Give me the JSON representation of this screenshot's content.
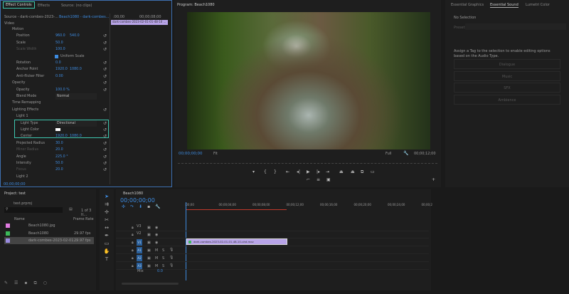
{
  "effect_controls": {
    "tabs": [
      "Effect Controls",
      "Effects",
      "Source: (no clips)"
    ],
    "source_label": "Source - dark-combes-2023-...",
    "clip_select": "Beach1080 - dark-combes...",
    "mini_time_start": ":00;00",
    "mini_time_end": "00;00;08;00",
    "clip_bar": "dark-combes-2023-02-01-01-48-10 ...",
    "section_video": "Video",
    "rows": [
      {
        "label": "Motion",
        "value": ""
      },
      {
        "label": "Position",
        "value": "960.0",
        "value2": "540.0"
      },
      {
        "label": "Scale",
        "value": "50.0"
      },
      {
        "label": "Scale Width",
        "value": "100.0"
      },
      {
        "label": "Uniform Scale",
        "value": ""
      },
      {
        "label": "Rotation",
        "value": "0.0"
      },
      {
        "label": "Anchor Point",
        "value": "1920.0",
        "value2": "1080.0"
      },
      {
        "label": "Anti-flicker Filter",
        "value": "0.00"
      },
      {
        "label": "Opacity",
        "value": ""
      },
      {
        "label": "Opacity",
        "value": "100.0 %"
      },
      {
        "label": "Blend Mode",
        "value": "Normal"
      },
      {
        "label": "Time Remapping",
        "value": ""
      },
      {
        "label": "Lighting Effects",
        "value": ""
      },
      {
        "label": "Light 1",
        "value": ""
      },
      {
        "label": "Light Type",
        "value": "Directional"
      },
      {
        "label": "Light Color",
        "value": ""
      },
      {
        "label": "Center",
        "value": "1920.0",
        "value2": "1080.0"
      },
      {
        "label": "Projected Radius",
        "value": "30.0"
      },
      {
        "label": "Minor Radius",
        "value": "20.0"
      },
      {
        "label": "Angle",
        "value": "225.0 °"
      },
      {
        "label": "Intensity",
        "value": "50.0"
      },
      {
        "label": "Focus",
        "value": "20.0"
      },
      {
        "label": "Light 2",
        "value": ""
      }
    ],
    "timecode": "00;00;00;00"
  },
  "program": {
    "title": "Program: Beach1080",
    "timecode": "00;00;00;00",
    "fit": "Fit",
    "quality": "Full",
    "duration": "00;00;12;00"
  },
  "right_panel": {
    "tabs": [
      "Essential Graphics",
      "Essential Sound",
      "Lumetri Color"
    ],
    "no_selection": "No Selection",
    "preset_label": "Preset:",
    "message": "Assign a Tag to the selection to enable editing options based on the Audio Type.",
    "buttons": [
      "Dialogue",
      "Music",
      "SFX",
      "Ambience"
    ]
  },
  "project": {
    "title": "Project: test",
    "file": "test.prproj",
    "count": "1 of 3 It...",
    "col_name": "Name",
    "col_fps": "Frame Rate",
    "items": [
      {
        "name": "Beach1080.jpg",
        "fps": "",
        "color": "#e07be0"
      },
      {
        "name": "Beach1080",
        "fps": "29.97 fps",
        "color": "#3cb85a"
      },
      {
        "name": "dark-combes-2023-02-01...",
        "fps": "29.97 fps",
        "color": "#9b8be0"
      }
    ]
  },
  "timeline": {
    "title": "Beach1080",
    "timecode": "00;00;00;00",
    "ruler": [
      ":00;00",
      "00;00;04;00",
      "00;00;08;00",
      "00;00;12;00",
      "00;00;16;00",
      "00;00;20;00",
      "00;00;24;00",
      "00;00;2"
    ],
    "tracks": [
      "V3",
      "V2",
      "V1",
      "A1",
      "A2",
      "A3"
    ],
    "mix_label": "Mix",
    "mix_value": "0.0",
    "clip": "dark-combes-2023-02-01-01-48-10-uhd.mov"
  }
}
